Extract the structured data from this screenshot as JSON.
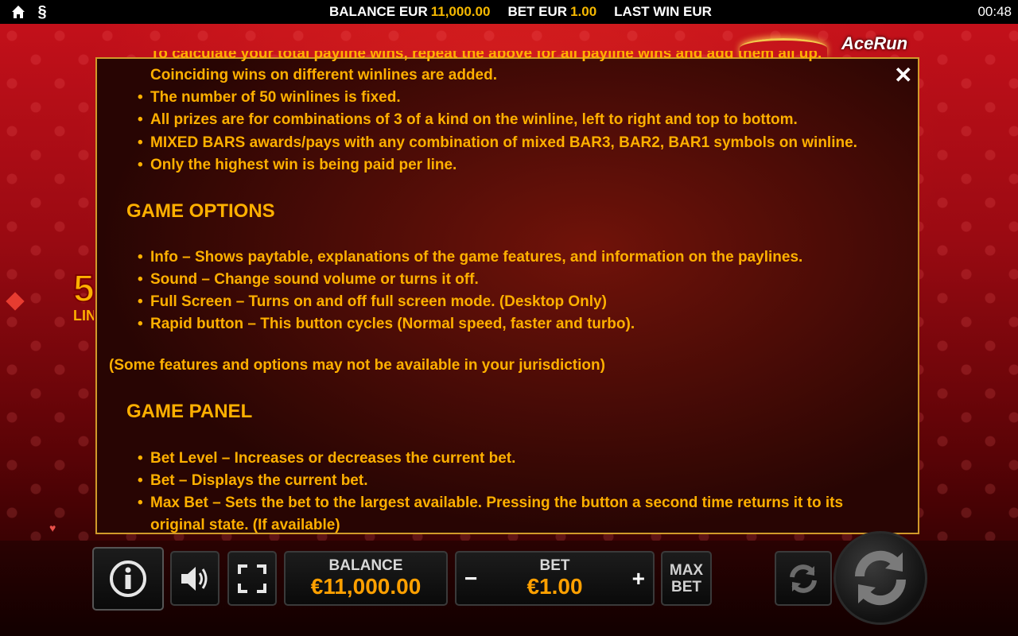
{
  "topbar": {
    "balance_label": "BALANCE EUR",
    "balance_value": "11,000.00",
    "bet_label": "BET EUR",
    "bet_value": "1.00",
    "lastwin_label": "LAST WIN EUR",
    "clock": "00:48"
  },
  "logo": "AceRun",
  "side": {
    "number": "5",
    "text": "LIN"
  },
  "panel": {
    "intro_cut": "To calculate your total payline wins, repeat the above for all payline wins and add them all up.",
    "rules": [
      "Coinciding wins on different winlines are added.",
      "The number of 50 winlines is fixed.",
      "All prizes are for combinations of 3 of a kind on the winline, left to right and top to bottom.",
      "MIXED BARS awards/pays with any combination of mixed BAR3, BAR2, BAR1 symbols on winline.",
      "Only the highest win is being paid per line."
    ],
    "game_options_heading": "GAME OPTIONS",
    "game_options": [
      "Info – Shows paytable, explanations of the game features, and information on the paylines.",
      "Sound – Change sound volume or turns it off.",
      "Full Screen – Turns on and off full screen mode. (Desktop Only)",
      "Rapid button – This button cycles (Normal speed, faster and turbo)."
    ],
    "jurisdiction_note": "(Some features and options may not be available in your jurisdiction)",
    "game_panel_heading": "GAME PANEL",
    "game_panel": [
      "Bet Level – Increases or decreases the current bet.",
      "Bet – Displays the current bet.",
      "Max Bet – Sets the bet to the largest available. Pressing the button a second time returns it to its",
      "original state. (If available)"
    ]
  },
  "controls": {
    "balance_label": "BALANCE",
    "balance_value": "€11,000.00",
    "bet_label": "BET",
    "bet_value": "€1.00",
    "minus": "−",
    "plus": "+",
    "maxbet_line1": "MAX",
    "maxbet_line2": "BET"
  }
}
